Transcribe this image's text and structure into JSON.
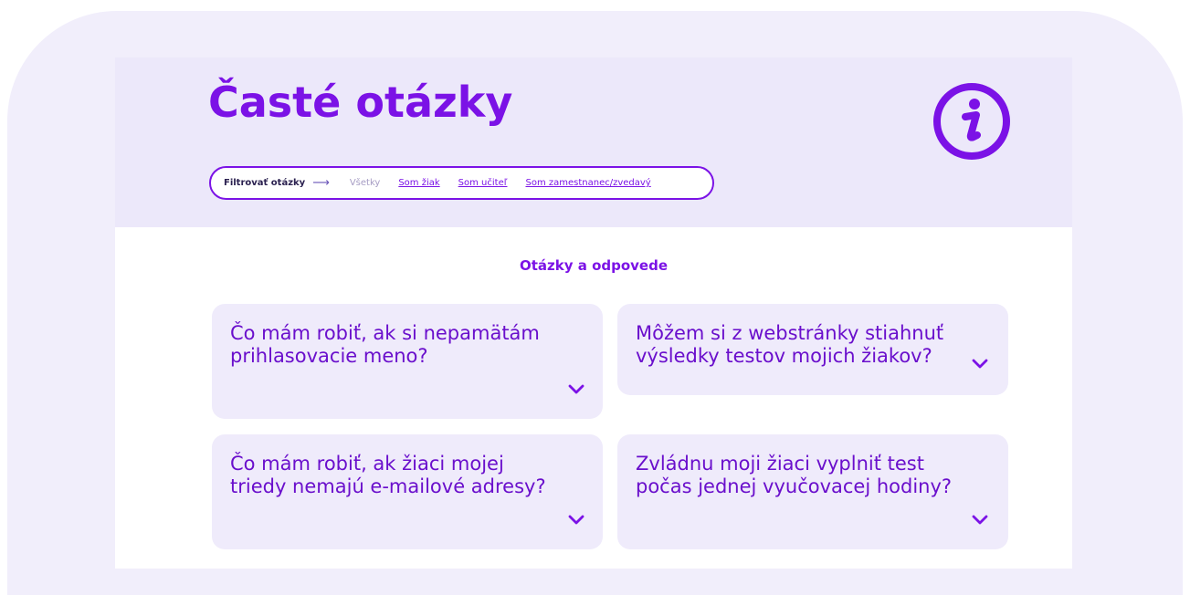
{
  "header": {
    "title": "Časté otázky"
  },
  "filter": {
    "label": "Filtrovať otázky",
    "arrow": "⟶",
    "options": [
      {
        "label": "Všetky",
        "active": false
      },
      {
        "label": "Som žiak",
        "active": true
      },
      {
        "label": "Som učiteľ",
        "active": true
      },
      {
        "label": "Som zamestnanec/zvedavý",
        "active": true
      }
    ]
  },
  "faq": {
    "section_title": "Otázky a odpovede",
    "items": [
      {
        "question": "Čo mám robiť, ak si nepamätám prihlasovacie meno?"
      },
      {
        "question": "Môžem si z webstránky stiahnuť výsledky testov mojich žiakov?"
      },
      {
        "question": "Čo mám robiť, ak žiaci mojej triedy nemajú e-mailové adresy?"
      },
      {
        "question": "Zvládnu moji žiaci vyplniť test počas jednej vyučovacej hodiny?"
      }
    ]
  },
  "colors": {
    "accent": "#7b12e6",
    "hero_bg": "#ece8fa",
    "card_bg": "#efebfb",
    "frame_bg": "#f1eefb"
  },
  "icons": {
    "info": "info-icon",
    "expand": "chevron-down-icon"
  }
}
